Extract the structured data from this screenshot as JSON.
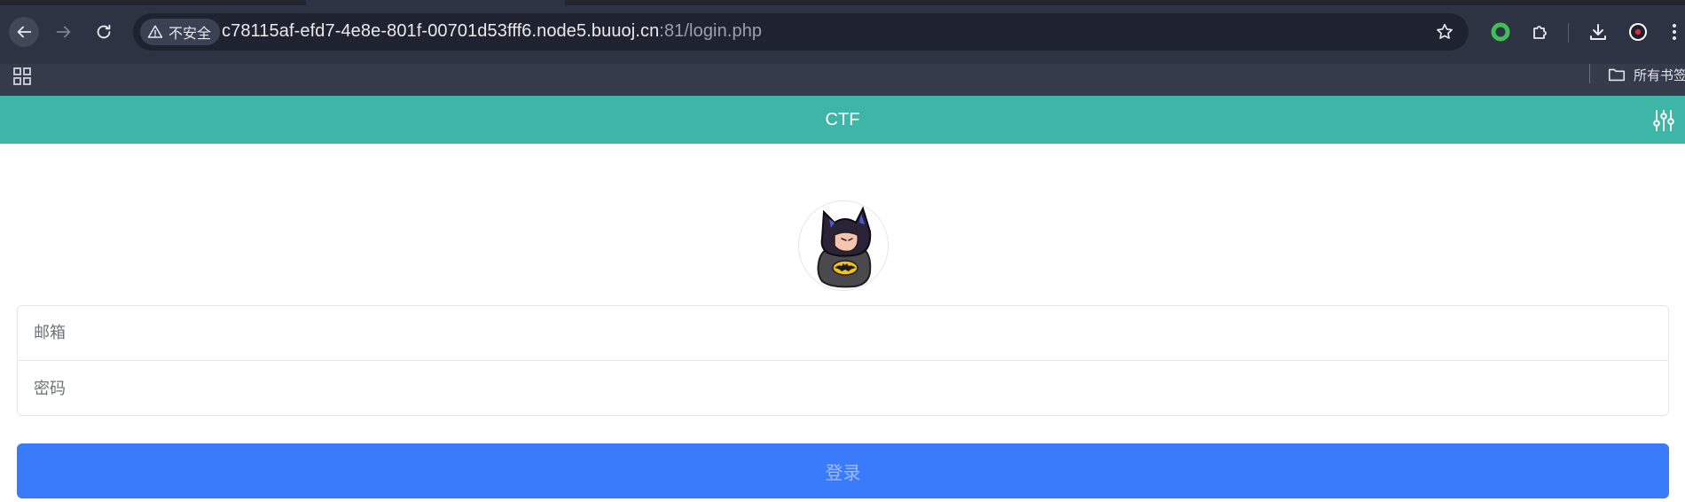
{
  "browser": {
    "security_label": "不安全",
    "url_host": "c78115af-efd7-4e8e-801f-00701d53fff6.node5.buuoj.cn",
    "url_rest": ":81/login.php",
    "bookmark_folder_label": "所有书签"
  },
  "page": {
    "header_title": "CTF",
    "header_color": "#3db6a8",
    "form": {
      "email_placeholder": "邮箱",
      "password_placeholder": "密码"
    },
    "login_button_label": "登录",
    "login_button_color": "#3a7bfb"
  },
  "icons": {
    "back": "arrow-left-icon",
    "forward": "arrow-right-icon",
    "reload": "reload-icon",
    "warning": "warning-triangle-icon",
    "star": "star-icon",
    "extension_green": "green-ring-extension-icon",
    "extensions": "puzzle-icon",
    "download": "download-icon",
    "profile": "profile-avatar-icon",
    "menu": "kebab-menu-icon",
    "apps": "apps-grid-icon",
    "folder": "folder-icon",
    "settings": "sliders-icon",
    "avatar": "batman-avatar"
  }
}
